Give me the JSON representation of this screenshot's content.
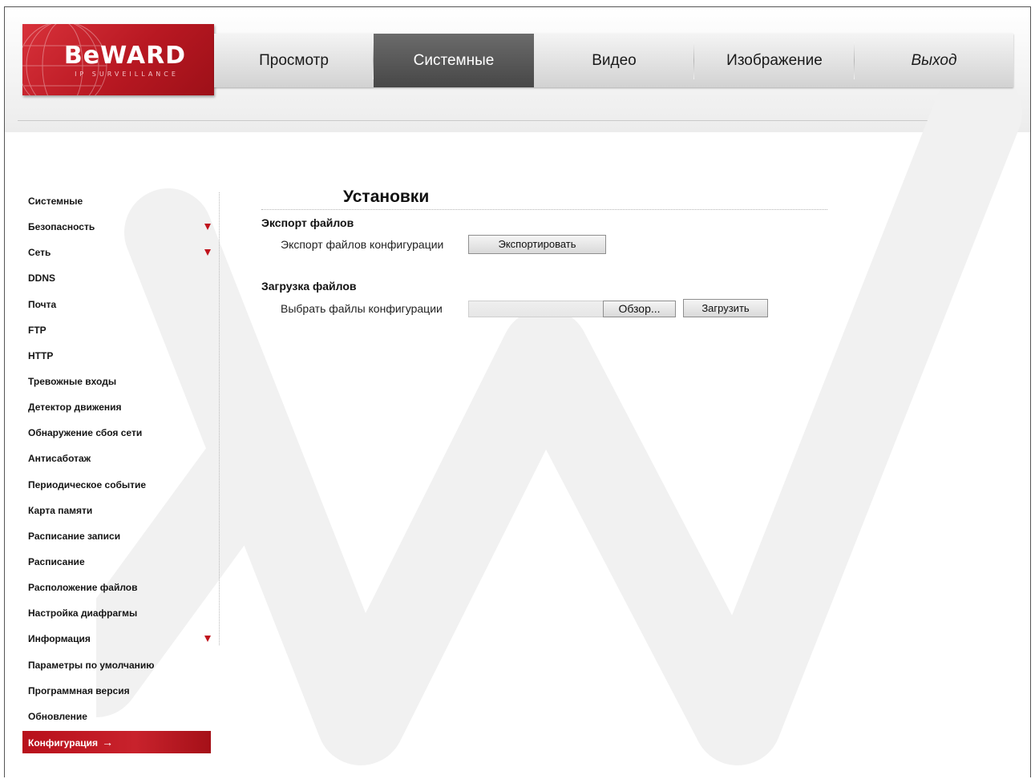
{
  "brand": {
    "logo_text": "BeWARD",
    "logo_subtext": "IP SURVEILLANCE"
  },
  "topnav": {
    "items": [
      {
        "label": "Просмотр",
        "active": false
      },
      {
        "label": "Системные",
        "active": true
      },
      {
        "label": "Видео",
        "active": false
      },
      {
        "label": "Изображение",
        "active": false
      },
      {
        "label": "Выход",
        "active": false
      }
    ]
  },
  "sidebar": {
    "items": [
      {
        "label": "Системные",
        "has_submenu": false
      },
      {
        "label": "Безопасность",
        "has_submenu": true
      },
      {
        "label": "Сеть",
        "has_submenu": true
      },
      {
        "label": "DDNS",
        "has_submenu": false
      },
      {
        "label": "Почта",
        "has_submenu": false
      },
      {
        "label": "FTP",
        "has_submenu": false
      },
      {
        "label": "HTTP",
        "has_submenu": false
      },
      {
        "label": "Тревожные входы",
        "has_submenu": false
      },
      {
        "label": "Детектор движения",
        "has_submenu": false
      },
      {
        "label": "Обнаружение сбоя сети",
        "has_submenu": false
      },
      {
        "label": "Антисаботаж",
        "has_submenu": false
      },
      {
        "label": "Периодическое событие",
        "has_submenu": false
      },
      {
        "label": "Карта памяти",
        "has_submenu": false
      },
      {
        "label": "Расписание записи",
        "has_submenu": false
      },
      {
        "label": "Расписание",
        "has_submenu": false
      },
      {
        "label": "Расположение файлов",
        "has_submenu": false
      },
      {
        "label": "Настройка диафрагмы",
        "has_submenu": false
      },
      {
        "label": "Информация",
        "has_submenu": true
      },
      {
        "label": "Параметры по умолчанию",
        "has_submenu": false
      },
      {
        "label": "Программная версия",
        "has_submenu": false
      },
      {
        "label": "Обновление",
        "has_submenu": false
      },
      {
        "label": "Конфигурация",
        "has_submenu": false,
        "active": true
      }
    ],
    "active_arrow": "→"
  },
  "main": {
    "title": "Установки",
    "export": {
      "heading": "Экспорт файлов",
      "label": "Экспорт файлов конфигурации",
      "button": "Экспортировать"
    },
    "upload": {
      "heading": "Загрузка файлов",
      "label": "Выбрать файлы конфигурации",
      "file_value": "",
      "browse_button": "Обзор...",
      "upload_button": "Загрузить"
    }
  },
  "colors": {
    "accent_red": "#c0141d",
    "nav_active": "#5a5a5a"
  }
}
